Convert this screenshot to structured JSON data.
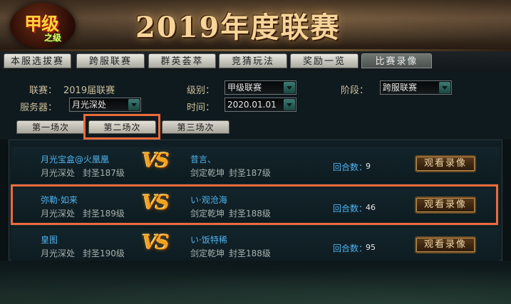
{
  "header": {
    "logo_main": "甲级",
    "logo_sub": "之级",
    "title": "2019年度联赛"
  },
  "main_tabs": [
    {
      "label": "本服选拔赛",
      "active": false
    },
    {
      "label": "跨服联赛",
      "active": false
    },
    {
      "label": "群英荟萃",
      "active": false
    },
    {
      "label": "竞猜玩法",
      "active": false
    },
    {
      "label": "奖励一览",
      "active": false
    },
    {
      "label": "比赛录像",
      "active": true
    }
  ],
  "filters": {
    "league_label": "联赛：",
    "league_value": "2019届联赛",
    "level_label": "级别：",
    "level_value": "甲级联赛",
    "stage_label": "阶段：",
    "stage_value": "跨服联赛",
    "server_label": "服务器：",
    "server_value": "月光深处",
    "time_label": "时间：",
    "time_value": "2020.01.01"
  },
  "sub_tabs": [
    {
      "label": "第一场次",
      "active": false
    },
    {
      "label": "第二场次",
      "active": true
    },
    {
      "label": "第三场次",
      "active": false
    }
  ],
  "vs_text": "VS",
  "round_label": "回合数：",
  "watch_label": "观看录像",
  "matches": [
    {
      "left": {
        "name": "月光宝盒@火凰凰",
        "server": "月光深处",
        "level": "封圣187级"
      },
      "right": {
        "name": "昔言、",
        "server": "剑定乾坤",
        "level": "封圣187级"
      },
      "rounds": "9"
    },
    {
      "left": {
        "name": "弥勒·如来",
        "server": "月光深处",
        "level": "封圣189级"
      },
      "right": {
        "name": "い·观沧海",
        "server": "剑定乾坤",
        "level": "封圣188级"
      },
      "rounds": "46"
    },
    {
      "left": {
        "name": "皇图",
        "server": "月光深处",
        "level": "封圣190级"
      },
      "right": {
        "name": "い·饭特稀",
        "server": "剑定乾坤",
        "level": "封圣188级"
      },
      "rounds": "95"
    }
  ],
  "colors": {
    "highlight": "#ec6a3c",
    "player_name": "#4fb3f0",
    "vs": "#f3a21b"
  }
}
